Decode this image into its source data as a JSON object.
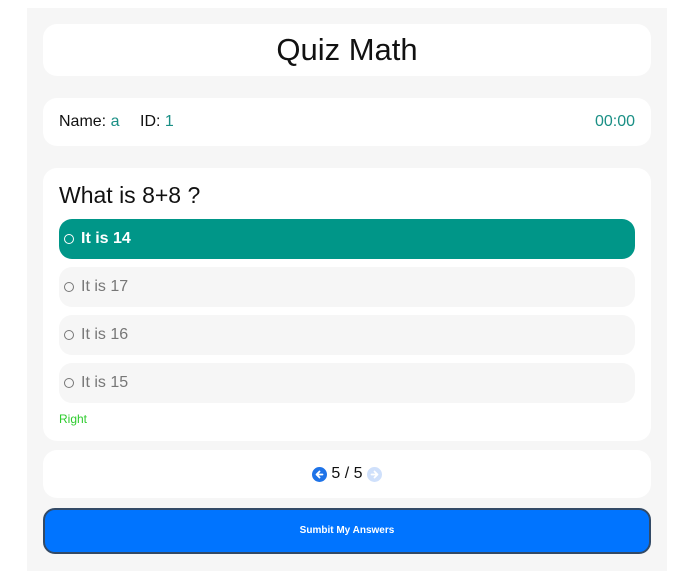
{
  "title": "Quiz Math",
  "student": {
    "name_label": "Name:",
    "name_value": "a",
    "id_label": "ID:",
    "id_value": "1",
    "timer": "00:00"
  },
  "question": {
    "text": "What is 8+8 ?",
    "options": [
      {
        "label": "It is 14",
        "selected": true
      },
      {
        "label": "It is 17",
        "selected": false
      },
      {
        "label": "It is 16",
        "selected": false
      },
      {
        "label": "It is 15",
        "selected": false
      }
    ],
    "result": "Right"
  },
  "pagination": {
    "current": "5",
    "separator": "/",
    "total": "5",
    "prev_icon": "arrow-left-circle",
    "next_icon": "arrow-right-circle"
  },
  "submit_label": "Sumbit My Answers",
  "colors": {
    "accent": "#009688",
    "result": "#2ecc2e",
    "button": "#0074ff"
  }
}
